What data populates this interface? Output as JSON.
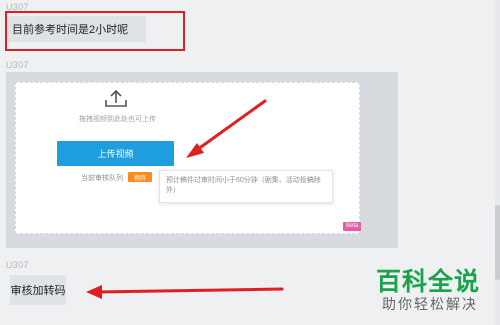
{
  "messages": [
    {
      "sender": "U307",
      "text": "目前参考时间是2小时呢"
    },
    {
      "sender": "U307",
      "type": "image"
    },
    {
      "sender": "U307",
      "text": "审核加转码"
    }
  ],
  "upload_panel": {
    "hint": "拖拽视频到此处也可上传",
    "upload_button": "上传视频",
    "queue_label": "当前审核队列",
    "queue_status": "拥挤",
    "tooltip": "预计稿件过审时间小于60分钟（剧集、活动投稿除外）",
    "beta_label": "Beta"
  },
  "watermark": {
    "title": "百科全说",
    "subtitle": "助你轻松解决"
  },
  "colors": {
    "annotation": "#e02020",
    "upload_button": "#1e9ede",
    "queue_badge": "#ff8a1f",
    "beta_badge": "#e85ba7",
    "watermark": "#1aa34a"
  },
  "icons": [
    "upload-icon"
  ]
}
